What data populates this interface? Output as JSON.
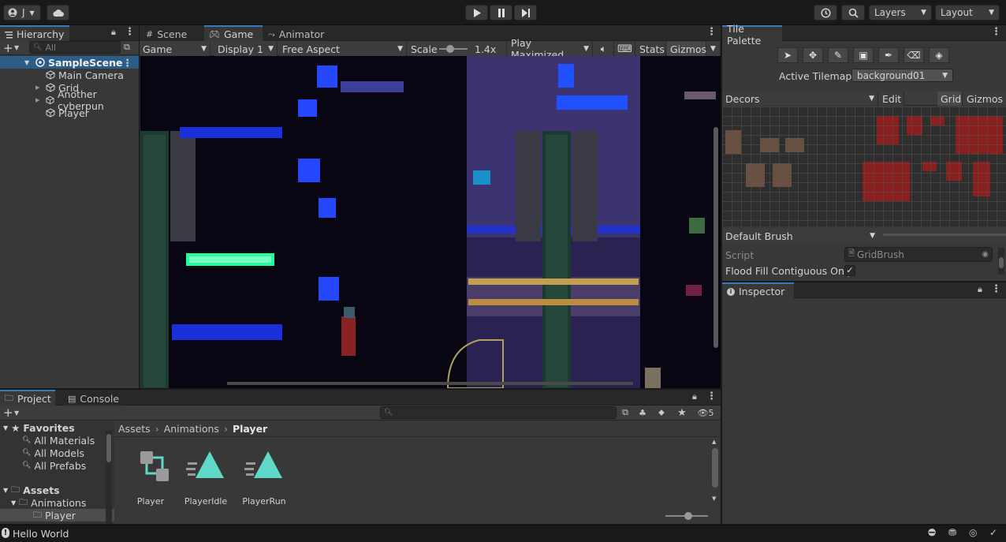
{
  "topbar": {
    "account_label": "J",
    "layers_label": "Layers",
    "layout_label": "Layout"
  },
  "hierarchy": {
    "tab_label": "Hierarchy",
    "search_placeholder": "All",
    "scene_name": "SampleScene",
    "items": [
      {
        "label": "Main Camera",
        "expandable": false
      },
      {
        "label": "Grid",
        "expandable": true
      },
      {
        "label": "Another cyberpun",
        "expandable": true
      },
      {
        "label": "Player",
        "expandable": false
      }
    ]
  },
  "center_tabs": [
    {
      "label": "Scene",
      "icon": "hash-icon"
    },
    {
      "label": "Game",
      "icon": "gamepad-icon"
    },
    {
      "label": "Animator",
      "icon": "animator-icon"
    }
  ],
  "game_toolbar": {
    "mode": "Game",
    "display": "Display 1",
    "aspect": "Free Aspect",
    "scale_label": "Scale",
    "scale_value": "1.4x",
    "play_mode": "Play Maximized",
    "stats": "Stats",
    "gizmos": "Gizmos"
  },
  "tile_palette": {
    "tab_label": "Tile Palette",
    "tools": [
      "select-tool-icon",
      "move-tool-icon",
      "brush-tool-icon",
      "box-fill-tool-icon",
      "picker-tool-icon",
      "eraser-tool-icon",
      "fill-tool-icon"
    ],
    "active_tilemap_label": "Active Tilemap",
    "active_tilemap_value": "background01",
    "palette_name": "Decors",
    "edit_label": "Edit",
    "grid_label": "Grid",
    "gizmos_label": "Gizmos",
    "brush_name": "Default Brush",
    "script_label": "Script",
    "script_value": "GridBrush",
    "flood_fill_label": "Flood Fill Contiguous Only",
    "flood_fill_checked": true
  },
  "inspector": {
    "tab_label": "Inspector"
  },
  "project": {
    "tab_project": "Project",
    "tab_console": "Console",
    "hidden_count": "5",
    "favorites_label": "Favorites",
    "favorites": [
      "All Materials",
      "All Models",
      "All Prefabs"
    ],
    "assets_label": "Assets",
    "animations_label": "Animations",
    "player_folder_label": "Player",
    "breadcrumb": [
      "Assets",
      "Animations",
      "Player"
    ],
    "files": [
      {
        "name": "Player",
        "icon": "animator-controller-icon"
      },
      {
        "name": "PlayerIdle",
        "icon": "animation-clip-icon"
      },
      {
        "name": "PlayerRun",
        "icon": "animation-clip-icon"
      }
    ]
  },
  "statusbar": {
    "message": "Hello World"
  },
  "colors": {
    "accent": "#3a79bb",
    "selected_row": "#2c5d87",
    "anim_icon": "#5fd8c8"
  }
}
